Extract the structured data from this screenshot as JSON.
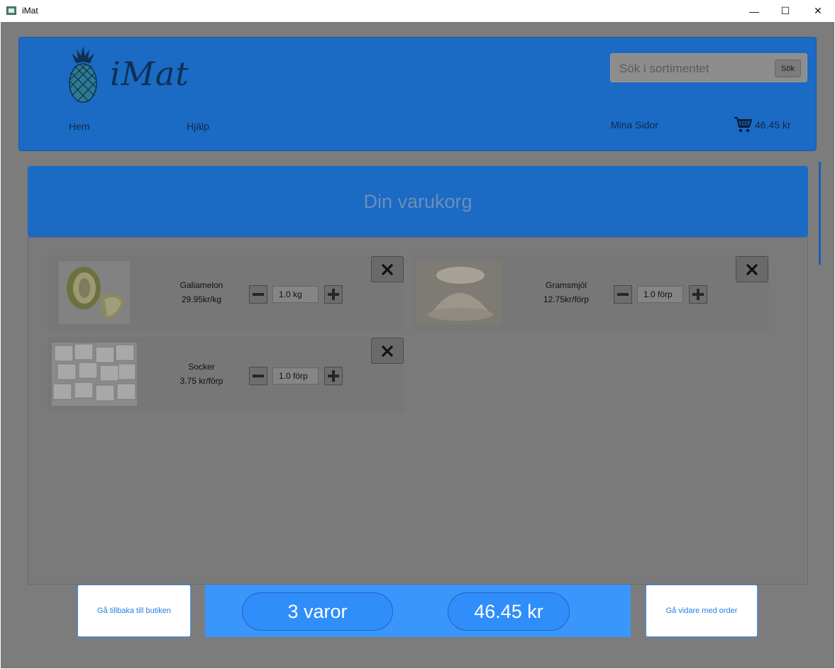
{
  "window": {
    "title": "iMat",
    "minimize": "—",
    "maximize": "☐",
    "close": "✕"
  },
  "header": {
    "logo_text": "iMat",
    "search": {
      "placeholder": "Sök i sortimentet",
      "button": "Sök"
    },
    "nav": {
      "home": "Hem",
      "help": "Hjälp",
      "my_pages": "Mina Sidor"
    },
    "cart_total": "46.45 kr"
  },
  "banner": {
    "title": "Din varukorg"
  },
  "cart": {
    "items": [
      {
        "name": "Galiamelon",
        "price": "29.95kr/kg",
        "quantity": "1.0 kg"
      },
      {
        "name": "Gramsmjöl",
        "price": "12.75kr/förp",
        "quantity": "1.0 förp"
      },
      {
        "name": "Socker",
        "price": "3.75  kr/förp",
        "quantity": "1.0 förp"
      }
    ]
  },
  "footer": {
    "back_button": "Gå tillbaka till butiken",
    "item_count": "3 varor",
    "total": "46.45 kr",
    "next_button": "Gå vidare med order"
  },
  "colors": {
    "brand_blue": "#1b6ac4",
    "accent_blue": "#3a96fb",
    "overlay_gray": "#7c7c7c"
  }
}
